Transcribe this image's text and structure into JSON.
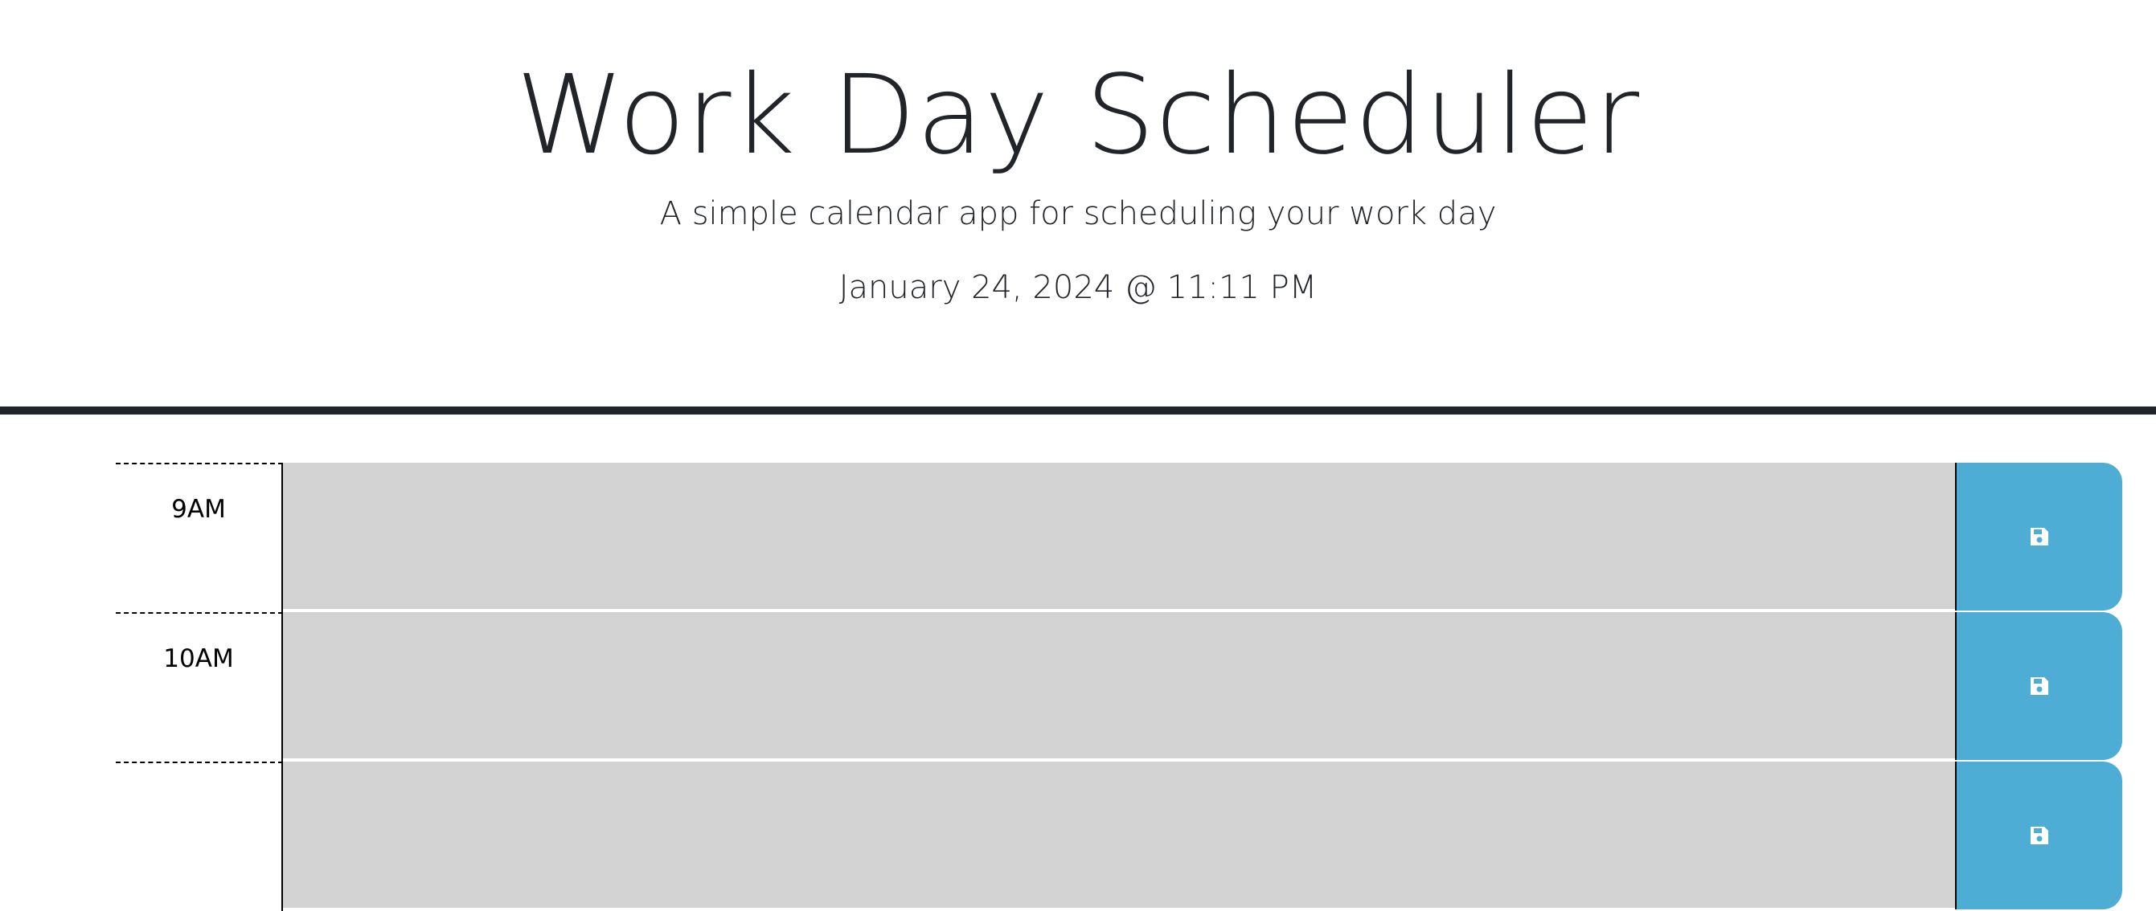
{
  "header": {
    "title": "Work Day Scheduler",
    "subtitle": "A simple calendar app for scheduling your work day",
    "current_day": "January 24, 2024 @ 11:11 PM"
  },
  "time_blocks": [
    {
      "hour": "9AM",
      "description": "",
      "save_icon": "floppy-disk-icon"
    },
    {
      "hour": "10AM",
      "description": "",
      "save_icon": "floppy-disk-icon"
    },
    {
      "hour": "",
      "description": "",
      "save_icon": "floppy-disk-icon"
    }
  ],
  "colors": {
    "past_block": "#d3d3d3",
    "save_button": "#4eadd4",
    "divider": "#212529"
  }
}
